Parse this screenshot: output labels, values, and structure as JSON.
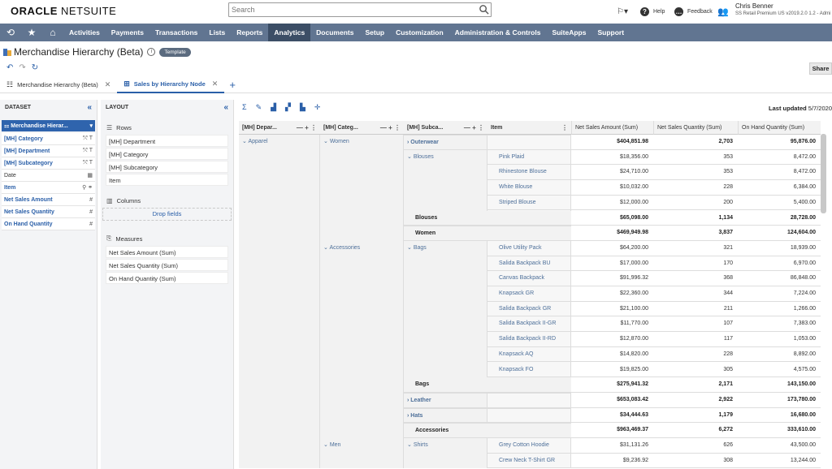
{
  "header": {
    "logo_bold": "ORACLE",
    "logo_thin": "NETSUITE",
    "search_placeholder": "Search",
    "help": "Help",
    "feedback": "Feedback",
    "user_name": "Chris Benner",
    "user_role": "SS Retail Premium US v2019.2.0 1.2 - Admi"
  },
  "nav": {
    "items": [
      "Activities",
      "Payments",
      "Transactions",
      "Lists",
      "Reports",
      "Analytics",
      "Documents",
      "Setup",
      "Customization",
      "Administration & Controls",
      "SuiteApps",
      "Support"
    ],
    "active": "Analytics"
  },
  "page": {
    "title": "Merchandise Hierarchy (Beta)",
    "badge": "Template",
    "share": "Share"
  },
  "tabs": [
    {
      "label": "Merchandise Hierarchy (Beta)",
      "active": false
    },
    {
      "label": "Sales by Hierarchy Node",
      "active": true
    }
  ],
  "dataset": {
    "heading": "DATASET",
    "selected": "Merchandise Hierar...",
    "fields": [
      {
        "label": "[MH] Category",
        "icons": "⤲ T",
        "linked": true
      },
      {
        "label": "[MH] Department",
        "icons": "⤲ T",
        "linked": true
      },
      {
        "label": "[MH] Subcategory",
        "icons": "⤲ T",
        "linked": true
      },
      {
        "label": "Date",
        "icons": "▦",
        "linked": false
      },
      {
        "label": "Item",
        "icons": "⚲ ⚭",
        "linked": true
      },
      {
        "label": "Net Sales Amount",
        "icons": "#",
        "linked": true
      },
      {
        "label": "Net Sales Quantity",
        "icons": "#",
        "linked": true
      },
      {
        "label": "On Hand Quantity",
        "icons": "#",
        "linked": true
      }
    ]
  },
  "layout": {
    "heading": "LAYOUT",
    "rows_title": "Rows",
    "rows": [
      "[MH] Department",
      "[MH] Category",
      "[MH] Subcategory",
      "Item"
    ],
    "columns_title": "Columns",
    "drop_fields": "Drop fields",
    "measures_title": "Measures",
    "measures": [
      "Net Sales Amount (Sum)",
      "Net Sales Quantity (Sum)",
      "On Hand Quantity (Sum)"
    ]
  },
  "pivot": {
    "last_updated_label": "Last updated",
    "last_updated_value": "5/7/2020",
    "row_headers": [
      "[MH] Depar...",
      "[MH] Categ...",
      "[MH] Subca...",
      "Item"
    ],
    "measure_headers": [
      "Net Sales Amount (Sum)",
      "Net Sales Quantity (Sum)",
      "On Hand Quantity (Sum)"
    ],
    "rows": [
      {
        "dept": "Apparel",
        "cat": "Women",
        "sub": "Outerwear",
        "item": "",
        "amount": "$404,851.98",
        "qty": "2,703",
        "onhand": "95,876.00",
        "bold": true
      },
      {
        "dept": "",
        "cat": "",
        "sub": "Blouses",
        "item": "Pink Plaid",
        "amount": "$18,356.00",
        "qty": "353",
        "onhand": "8,472.00",
        "bold": false
      },
      {
        "dept": "",
        "cat": "",
        "sub": "",
        "item": "Rhinestone Blouse",
        "amount": "$24,710.00",
        "qty": "353",
        "onhand": "8,472.00",
        "bold": false
      },
      {
        "dept": "",
        "cat": "",
        "sub": "",
        "item": "White Blouse",
        "amount": "$10,032.00",
        "qty": "228",
        "onhand": "6,384.00",
        "bold": false
      },
      {
        "dept": "",
        "cat": "",
        "sub": "",
        "item": "Striped Blouse",
        "amount": "$12,000.00",
        "qty": "200",
        "onhand": "5,400.00",
        "bold": false
      },
      {
        "dept": "",
        "cat": "",
        "sub": "",
        "item": "Blouses",
        "amount": "$65,098.00",
        "qty": "1,134",
        "onhand": "28,728.00",
        "bold": true,
        "total": true
      },
      {
        "dept": "",
        "cat": "",
        "sub": "Women",
        "item": "",
        "amount": "$469,949.98",
        "qty": "3,837",
        "onhand": "124,604.00",
        "bold": true,
        "cattotal": true
      },
      {
        "dept": "",
        "cat": "Accessories",
        "sub": "Bags",
        "item": "Olive Utility Pack",
        "amount": "$64,200.00",
        "qty": "321",
        "onhand": "18,939.00",
        "bold": false
      },
      {
        "dept": "",
        "cat": "",
        "sub": "",
        "item": "Salida Backpack BU",
        "amount": "$17,000.00",
        "qty": "170",
        "onhand": "6,970.00",
        "bold": false
      },
      {
        "dept": "",
        "cat": "",
        "sub": "",
        "item": "Canvas Backpack",
        "amount": "$91,996.32",
        "qty": "368",
        "onhand": "86,848.00",
        "bold": false
      },
      {
        "dept": "",
        "cat": "",
        "sub": "",
        "item": "Knapsack GR",
        "amount": "$22,360.00",
        "qty": "344",
        "onhand": "7,224.00",
        "bold": false
      },
      {
        "dept": "",
        "cat": "",
        "sub": "",
        "item": "Salida Backpack GR",
        "amount": "$21,100.00",
        "qty": "211",
        "onhand": "1,266.00",
        "bold": false
      },
      {
        "dept": "",
        "cat": "",
        "sub": "",
        "item": "Salida Backpack II-GR",
        "amount": "$11,770.00",
        "qty": "107",
        "onhand": "7,383.00",
        "bold": false
      },
      {
        "dept": "",
        "cat": "",
        "sub": "",
        "item": "Salida Backpack II-RD",
        "amount": "$12,870.00",
        "qty": "117",
        "onhand": "1,053.00",
        "bold": false
      },
      {
        "dept": "",
        "cat": "",
        "sub": "",
        "item": "Knapsack AQ",
        "amount": "$14,820.00",
        "qty": "228",
        "onhand": "8,892.00",
        "bold": false
      },
      {
        "dept": "",
        "cat": "",
        "sub": "",
        "item": "Knapsack FO",
        "amount": "$19,825.00",
        "qty": "305",
        "onhand": "4,575.00",
        "bold": false
      },
      {
        "dept": "",
        "cat": "",
        "sub": "",
        "item": "Bags",
        "amount": "$275,941.32",
        "qty": "2,171",
        "onhand": "143,150.00",
        "bold": true,
        "total": true
      },
      {
        "dept": "",
        "cat": "",
        "sub": "Leather",
        "item": "",
        "amount": "$653,083.42",
        "qty": "2,922",
        "onhand": "173,780.00",
        "bold": true
      },
      {
        "dept": "",
        "cat": "",
        "sub": "Hats",
        "item": "",
        "amount": "$34,444.63",
        "qty": "1,179",
        "onhand": "16,680.00",
        "bold": true
      },
      {
        "dept": "",
        "cat": "",
        "sub": "Accessories",
        "item": "",
        "amount": "$963,469.37",
        "qty": "6,272",
        "onhand": "333,610.00",
        "bold": true,
        "cattotal": true
      },
      {
        "dept": "",
        "cat": "Men",
        "sub": "Shirts",
        "item": "Grey Cotton Hoodie",
        "amount": "$31,131.26",
        "qty": "626",
        "onhand": "43,500.00",
        "bold": false
      },
      {
        "dept": "",
        "cat": "",
        "sub": "",
        "item": "Crew Neck T-Shirt GR",
        "amount": "$9,236.92",
        "qty": "308",
        "onhand": "13,244.00",
        "bold": false
      }
    ]
  }
}
